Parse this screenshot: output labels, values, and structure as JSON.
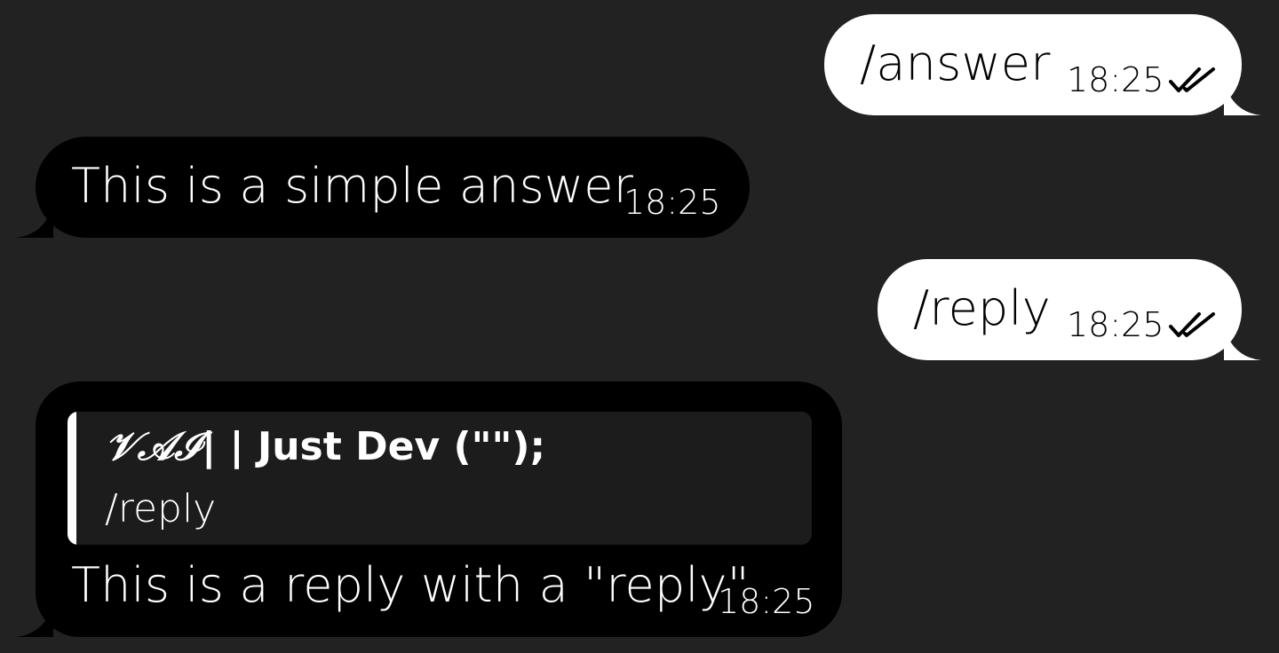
{
  "messages": [
    {
      "direction": "outgoing",
      "text": "/answer",
      "time": "18:25",
      "status_icon": "double-check-icon"
    },
    {
      "direction": "incoming",
      "text": "This is a simple answer",
      "time": "18:25"
    },
    {
      "direction": "outgoing",
      "text": "/reply",
      "time": "18:25",
      "status_icon": "double-check-icon"
    },
    {
      "direction": "incoming",
      "reply_to": {
        "author_prefix": "𝒱𝒜ℐ",
        "author_name": "| | Just Dev (\"\");",
        "text": "/reply"
      },
      "text": "This is a reply with a \"reply\"",
      "time": "18:25"
    }
  ],
  "colors": {
    "background": "#222222",
    "outgoing_bubble": "#ffffff",
    "incoming_bubble": "#000000",
    "quote_background": "#1c1c1c",
    "quote_bar": "#ffffff"
  }
}
